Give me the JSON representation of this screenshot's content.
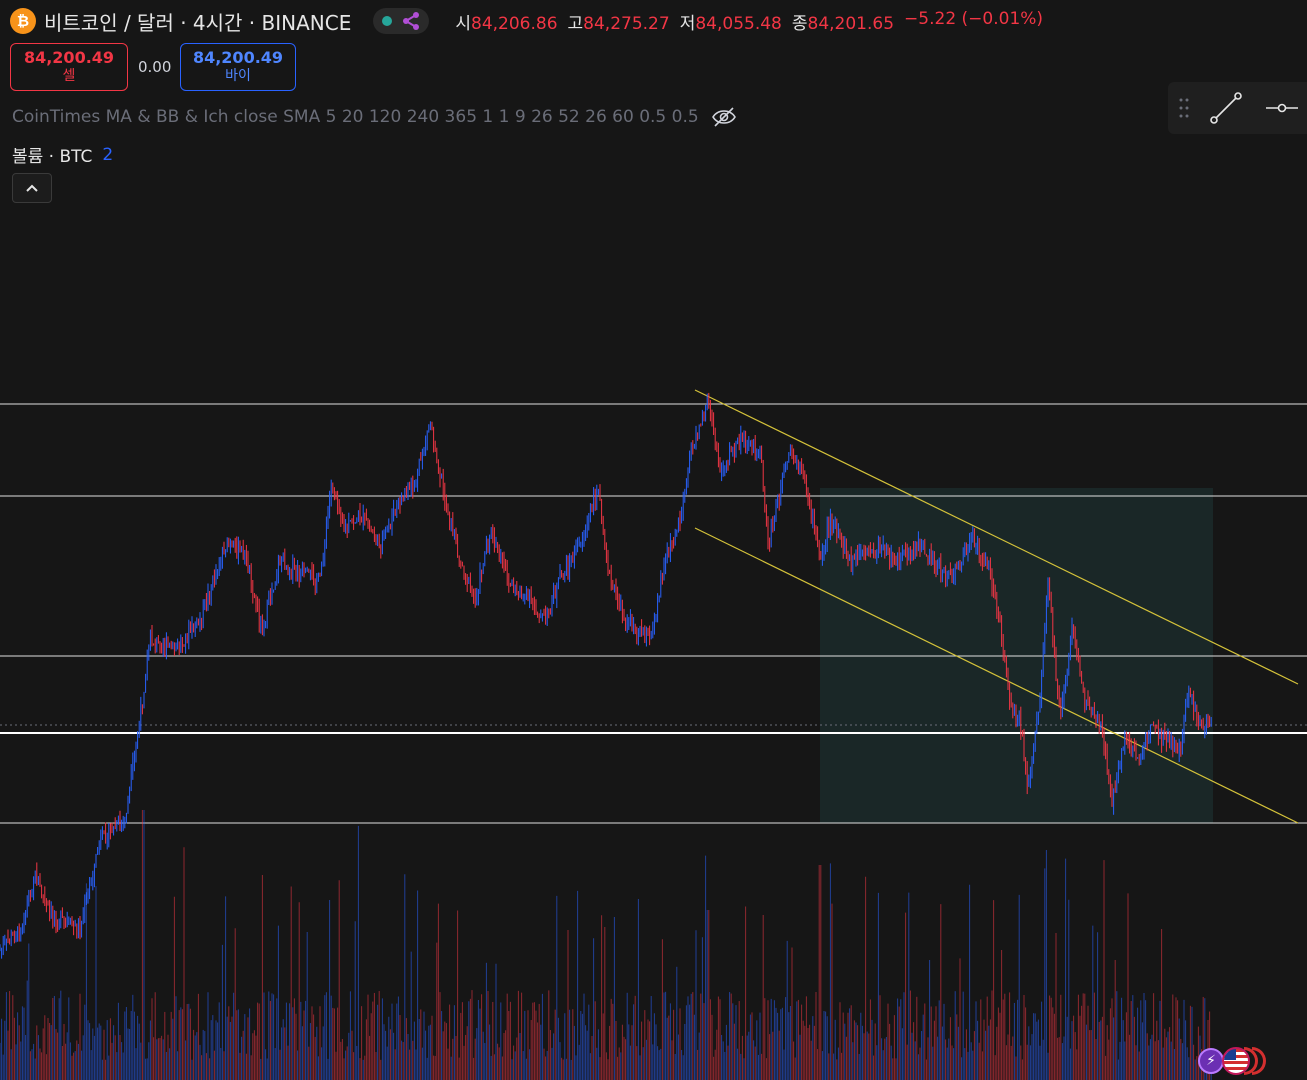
{
  "header": {
    "coin_icon_glyph": "₿",
    "symbol": "비트코인 / 달러 · 4시간 · BINANCE",
    "open_label": "시",
    "open_value": "84,206.86",
    "high_label": "고",
    "high_value": "84,275.27",
    "low_label": "저",
    "low_value": "84,055.48",
    "close_label": "종",
    "close_value": "84,201.65",
    "change": "−5.22 (−0.01%)"
  },
  "trade": {
    "sell_price": "84,200.49",
    "sell_label": "셀",
    "spread": "0.00",
    "buy_price": "84,200.49",
    "buy_label": "바이"
  },
  "indicator": {
    "text": "CoinTimes MA & BB & Ich close SMA 5 20 120 240 365 1 1 9 26 52 26 60 0.5 0.5"
  },
  "volume": {
    "label": "볼륨 · BTC",
    "count": "2"
  },
  "colors": {
    "background": "#161616",
    "up": "#2962ff",
    "down": "#f23645",
    "trendline": "#d4c23a",
    "level": "#e0e0e0",
    "zone": "#1b2a2a"
  },
  "icons": {
    "status": "green-dot-icon",
    "share": "share-icon",
    "hide": "eye-slash-icon",
    "collapse": "chevron-up-icon",
    "drag": "drag-handle-icon",
    "trend_tool": "trend-line-icon",
    "horizontal_tool": "horizontal-ray-icon",
    "flash": "flash-icon",
    "flag": "us-flag-icon"
  }
}
